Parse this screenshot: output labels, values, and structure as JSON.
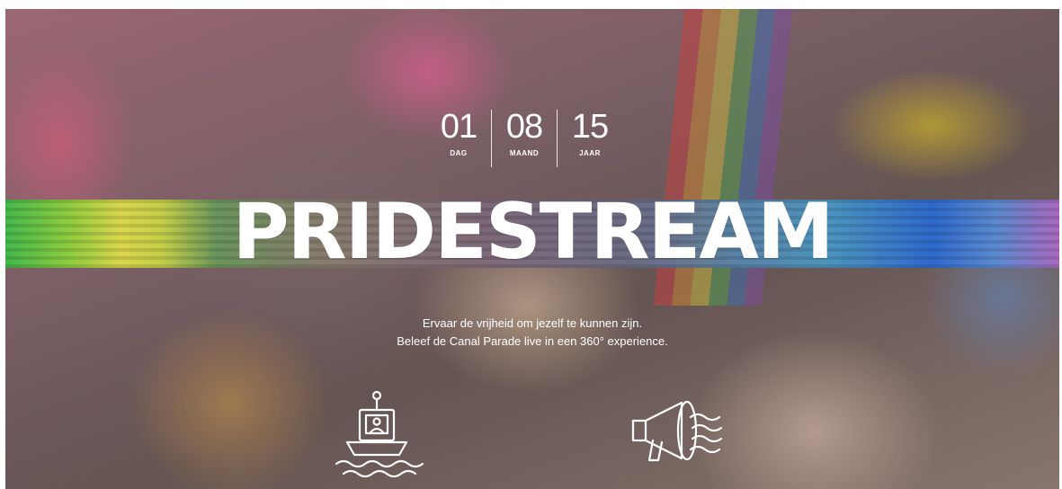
{
  "date": {
    "day": {
      "value": "01",
      "label": "DAG"
    },
    "month": {
      "value": "08",
      "label": "MAAND"
    },
    "year": {
      "value": "15",
      "label": "JAAR"
    }
  },
  "title": "PRIDESTREAM",
  "tagline": {
    "line1": "Ervaar de vrijheid om jezelf te kunnen zijn.",
    "line2": "Beleef de Canal Parade live in een 360° experience."
  },
  "icons": {
    "left": "boat-camera-icon",
    "right": "megaphone-icon"
  },
  "colors": {
    "text": "#ffffff",
    "band_start": "#3ec04a",
    "band_end": "#2a6bd8"
  }
}
